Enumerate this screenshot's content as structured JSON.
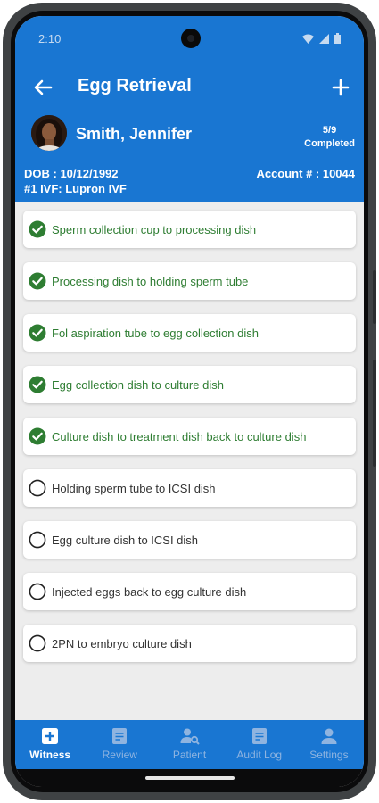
{
  "status_bar": {
    "time": "2:10"
  },
  "header": {
    "title": "Egg Retrieval",
    "patient_name": "Smith, Jennifer",
    "progress_count": "5/9",
    "progress_label": "Completed",
    "dob": "DOB : 10/12/1992",
    "cycle": "#1 IVF: Lupron IVF",
    "account": "Account # : 10044"
  },
  "checklist": [
    {
      "label": "Sperm collection cup to processing dish",
      "done": true
    },
    {
      "label": "Processing dish to holding sperm tube",
      "done": true
    },
    {
      "label": "Fol aspiration tube to egg collection dish",
      "done": true
    },
    {
      "label": "Egg collection dish to culture dish",
      "done": true
    },
    {
      "label": "Culture dish to treatment dish back to culture dish",
      "done": true
    },
    {
      "label": "Holding sperm tube to ICSI dish",
      "done": false
    },
    {
      "label": "Egg culture dish to ICSI dish",
      "done": false
    },
    {
      "label": "Injected eggs back to egg culture dish",
      "done": false
    },
    {
      "label": "2PN to embryo culture dish",
      "done": false
    }
  ],
  "nav": [
    {
      "label": "Witness",
      "icon": "plus-square-icon",
      "active": true
    },
    {
      "label": "Review",
      "icon": "document-icon",
      "active": false
    },
    {
      "label": "Patient",
      "icon": "person-search-icon",
      "active": false
    },
    {
      "label": "Audit Log",
      "icon": "document-icon",
      "active": false
    },
    {
      "label": "Settings",
      "icon": "person-icon",
      "active": false
    }
  ],
  "colors": {
    "primary": "#1976d2",
    "done_green": "#2e7d32",
    "nav_inactive": "#8fb4e0"
  }
}
